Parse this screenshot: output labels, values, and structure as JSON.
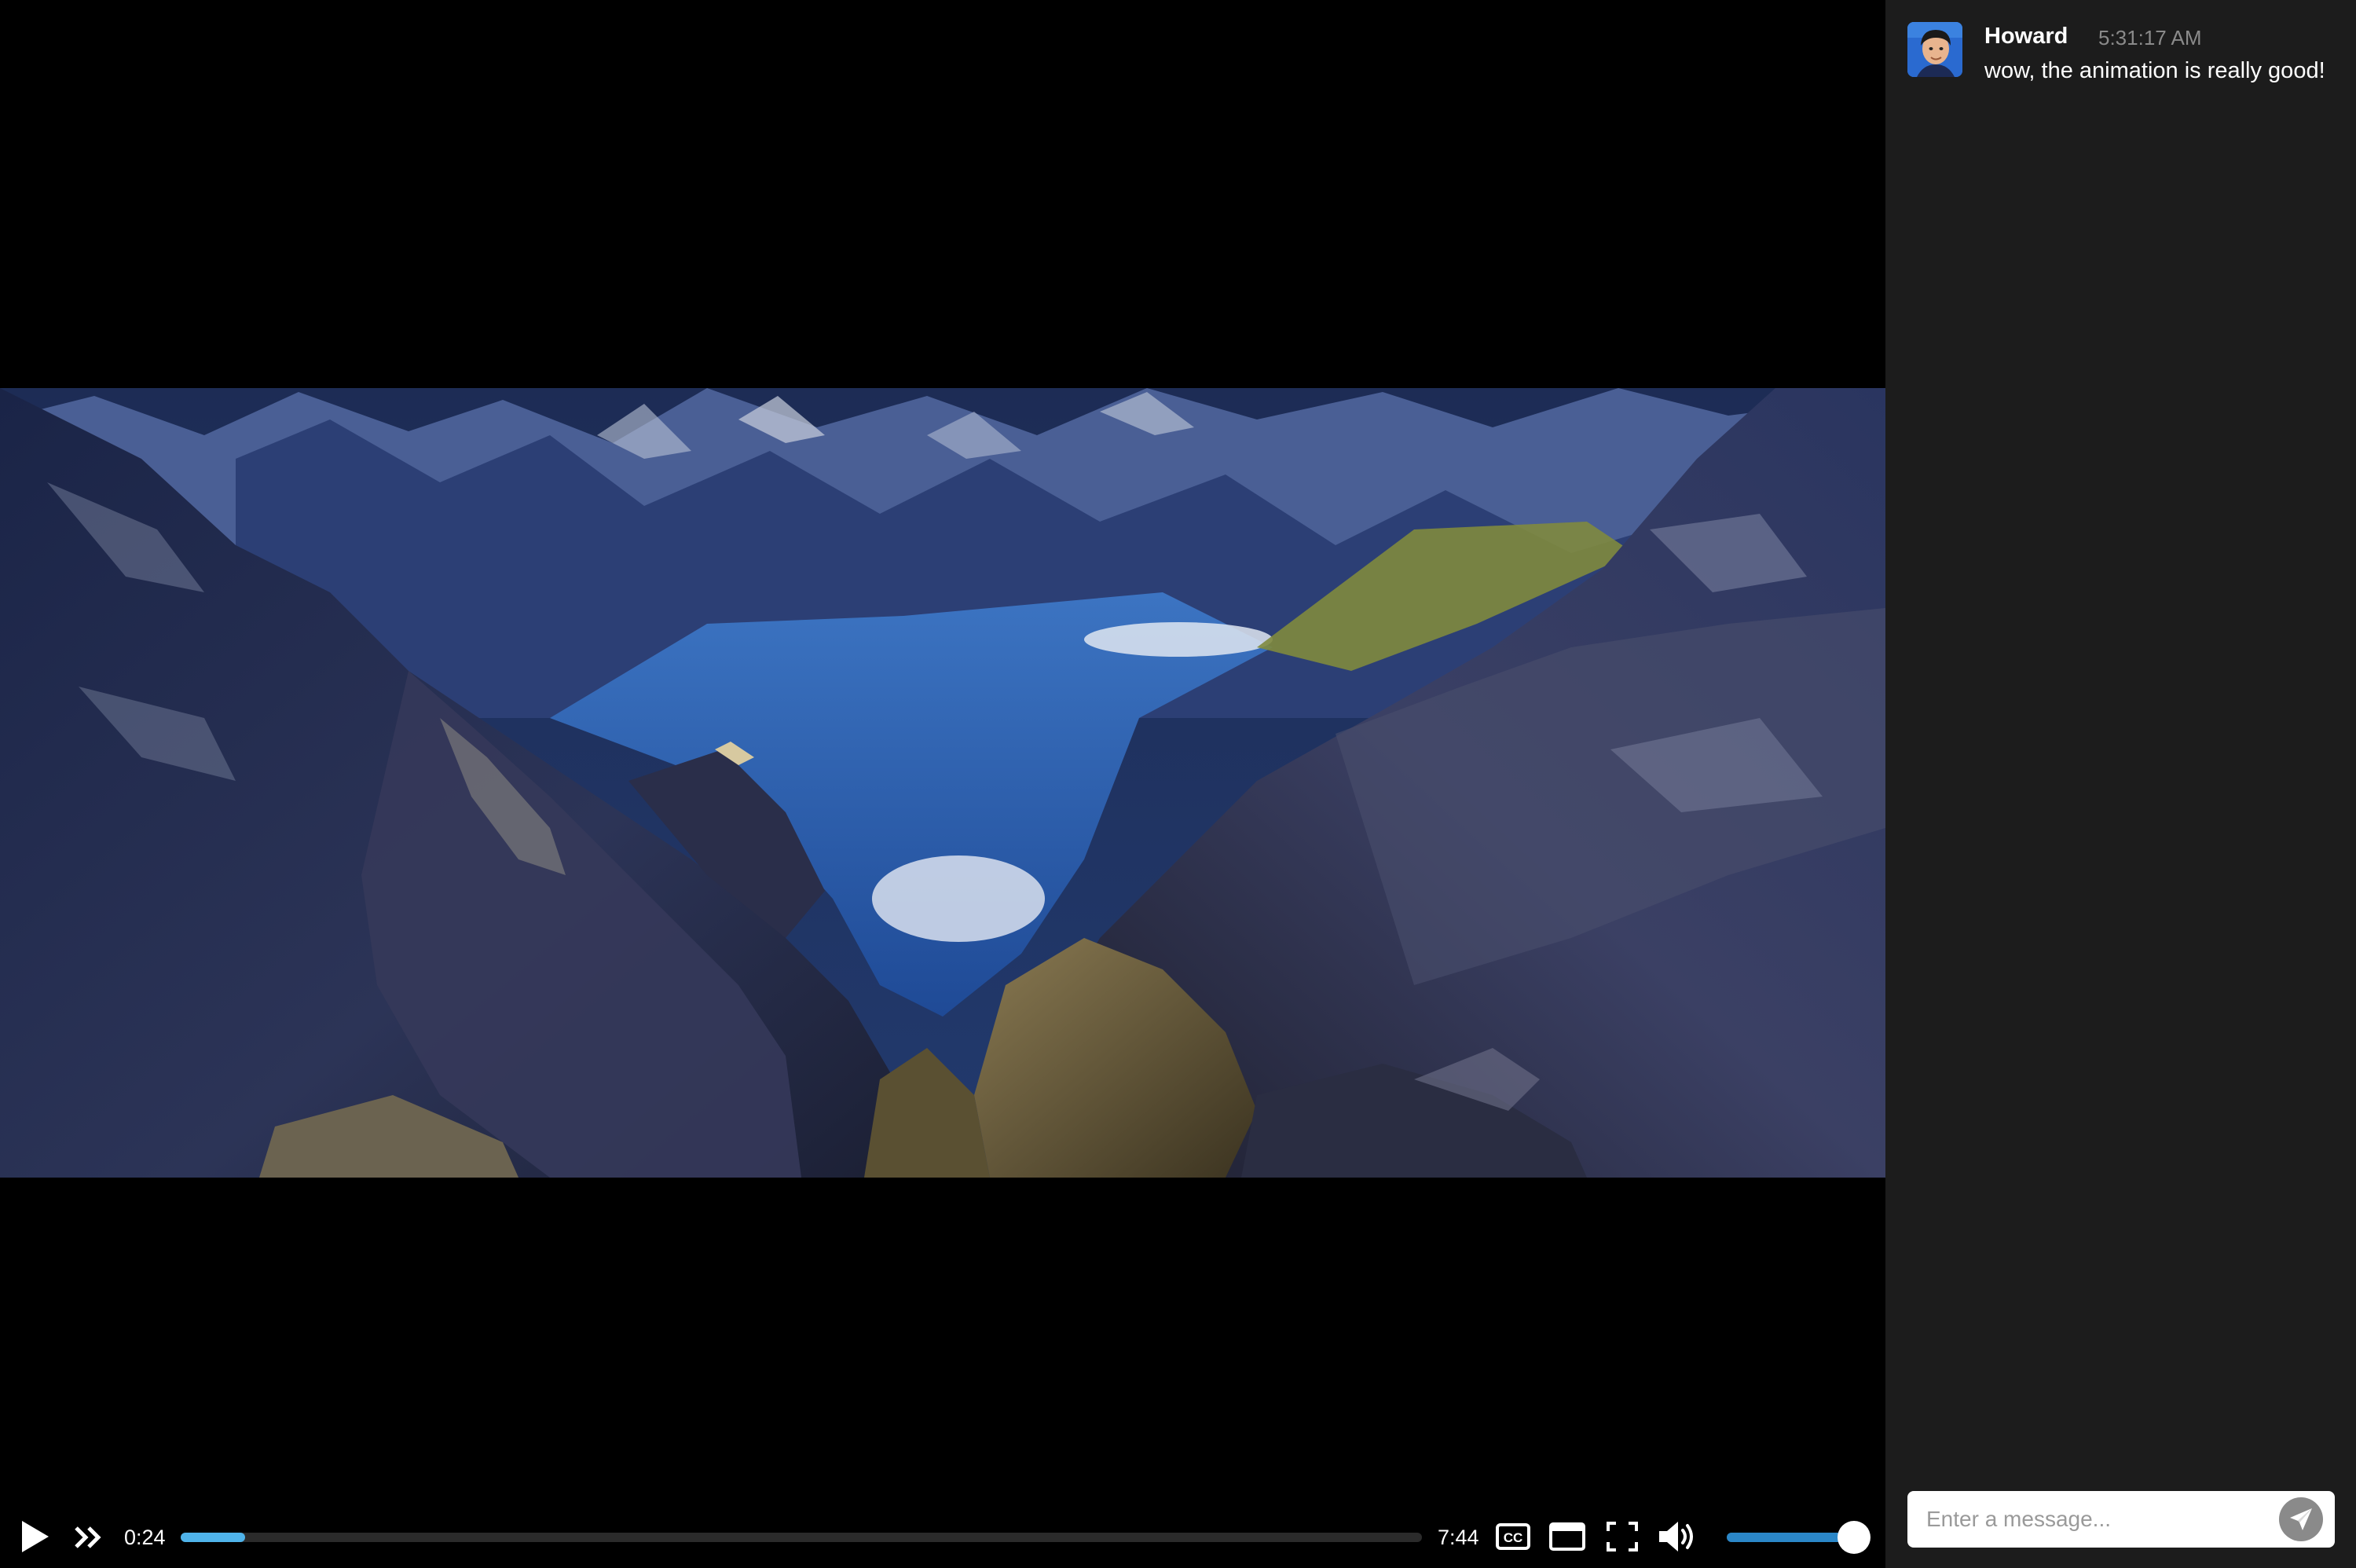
{
  "player": {
    "current_time": "0:24",
    "duration": "7:44",
    "progress_fraction": 0.052,
    "volume_fraction": 1.0,
    "accent_color": "#4fb3ea",
    "icons": {
      "play": "play-icon",
      "skip": "skip-forward-icon",
      "captions": "closed-captions-icon",
      "theater": "theater-mode-icon",
      "fullscreen": "fullscreen-icon",
      "volume": "volume-icon"
    }
  },
  "chat": {
    "messages": [
      {
        "author": "Howard",
        "time": "5:31:17 AM",
        "text": "wow, the animation is really good!"
      }
    ],
    "input_placeholder": "Enter a message...",
    "input_value": "",
    "send_icon": "send-icon"
  }
}
